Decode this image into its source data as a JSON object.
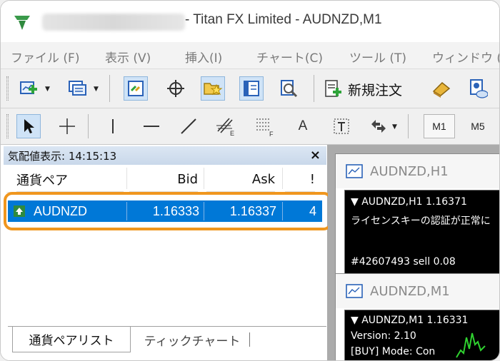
{
  "window": {
    "title": "- Titan FX Limited - AUDNZD,M1",
    "logo_icon": "titan-fx-logo-icon"
  },
  "menu": {
    "items": [
      "ファイル (F)",
      "表示 (V)",
      "挿入(I)",
      "チャート(C)",
      "ツール (T)",
      "ウィンドウ (W)"
    ]
  },
  "toolbar": {
    "new_order_label": "新規注文",
    "icons": [
      "new-chart-icon",
      "profiles-icon",
      "market-watch-icon",
      "crosshair-target-icon",
      "navigator-icon",
      "terminal-icon",
      "strategy-tester-icon",
      "new-order-icon",
      "autotrading-icon",
      "options-icon"
    ]
  },
  "toolbar2": {
    "tools": [
      "cursor-icon",
      "crosshair-icon",
      "vertical-line-icon",
      "horizontal-line-icon",
      "trendline-icon",
      "fibonacci-fan-icon",
      "fibonacci-retracement-icon",
      "text-icon",
      "text-label-icon",
      "arrows-icon"
    ],
    "text_tool_label": "A",
    "timeframes": [
      "M1",
      "M5"
    ]
  },
  "market_watch": {
    "title": "気配値表示: 14:15:13",
    "close_label": "×",
    "columns": {
      "symbol": "通貨ペア",
      "bid": "Bid",
      "ask": "Ask",
      "spread": "!"
    },
    "rows": [
      {
        "symbol": "AUDNZD",
        "bid": "1.16333",
        "ask": "1.16337",
        "spread": "4",
        "direction": "up"
      }
    ],
    "tabs": [
      "通貨ペアリスト",
      "ティックチャート"
    ],
    "selection_color": "#0078d7",
    "highlight_color": "#f0961e"
  },
  "charts": [
    {
      "title": "AUDNZD,H1",
      "lines": [
        "▼ AUDNZD,H1  1.16371",
        "ライセンスキーの認証が正常に",
        "#42607493 sell 0.08"
      ]
    },
    {
      "title": "AUDNZD,M1",
      "lines": [
        "▼ AUDNZD,M1  1.16331",
        "Version: 2.10",
        "[BUY] Mode: Con"
      ]
    }
  ]
}
